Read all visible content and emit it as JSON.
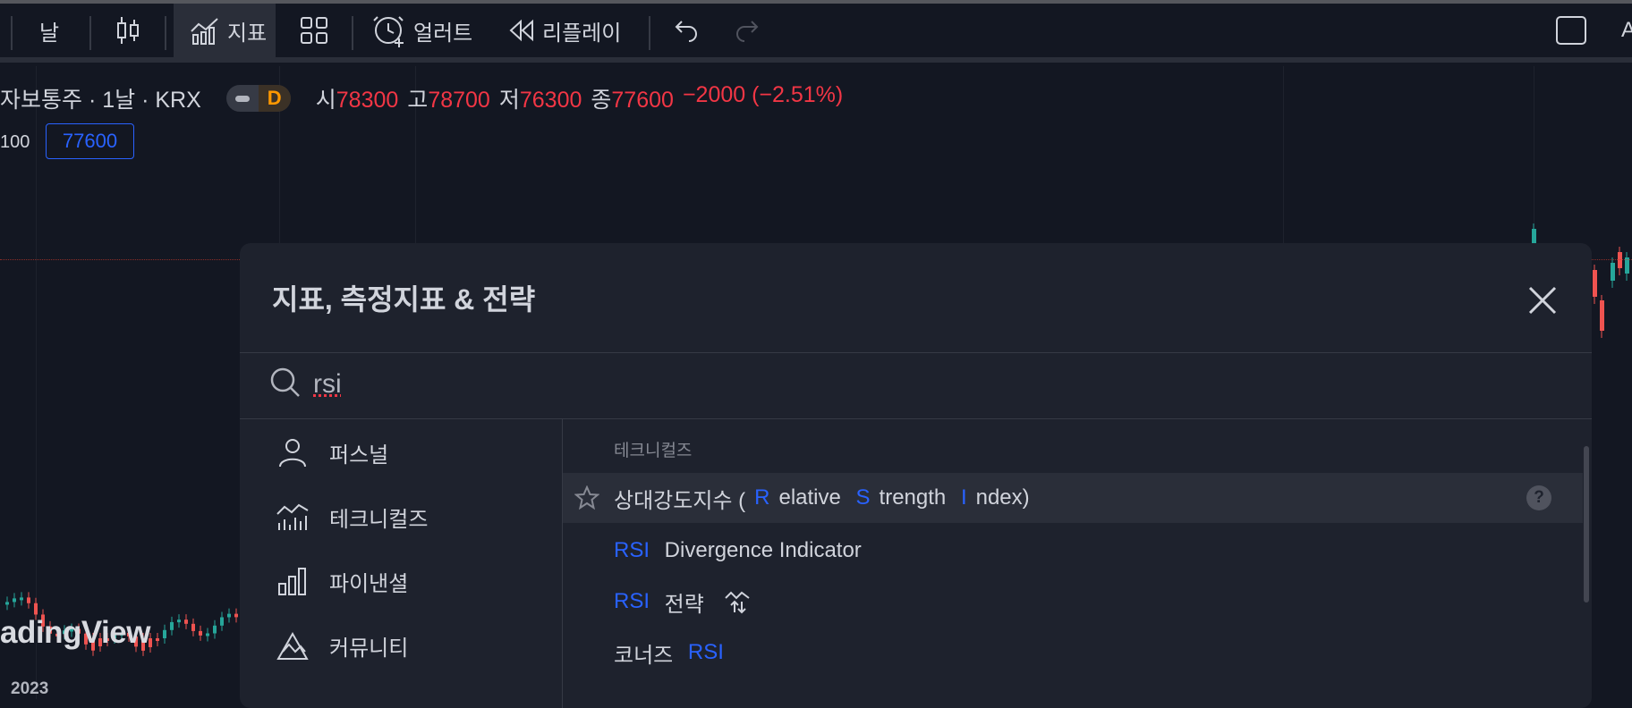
{
  "toolbar": {
    "interval_label": "날",
    "indicators_label": "지표",
    "alert_label": "얼러트",
    "replay_label": "리플레이"
  },
  "legend": {
    "symbol": "자보통주 · 1날 · KRX",
    "badge": "D",
    "open_label": "시",
    "open": "78300",
    "high_label": "고",
    "high": "78700",
    "low_label": "저",
    "low": "76300",
    "close_label": "종",
    "close": "77600",
    "change": "−2000 (−2.51%)"
  },
  "left_number": "100",
  "price_box": "77600",
  "watermark": "adingView",
  "year_label": "2023",
  "colors": {
    "up": "#26a69a",
    "down": "#ef5350",
    "accent": "#2962ff",
    "badge": "#ff9800"
  },
  "dialog": {
    "title": "지표, 측정지표 & 전략",
    "search_value": "rsi",
    "categories": [
      {
        "label": "퍼스널",
        "icon": "user-icon"
      },
      {
        "label": "테크니컬즈",
        "icon": "technicals-icon"
      },
      {
        "label": "파이낸셜",
        "icon": "bar-chart-icon"
      },
      {
        "label": "커뮤니티",
        "icon": "community-icon"
      }
    ],
    "section_label": "테크니컬즈",
    "results": [
      {
        "parts": [
          "상대강도지수 (",
          "R",
          "elative ",
          "S",
          "trength ",
          "I",
          "ndex)"
        ]
      },
      {
        "parts": [
          "RSI",
          " Divergence Indicator"
        ]
      },
      {
        "parts": [
          "RSI",
          " 전략"
        ]
      },
      {
        "parts": [
          "코너즈 ",
          "RSI"
        ]
      }
    ]
  }
}
